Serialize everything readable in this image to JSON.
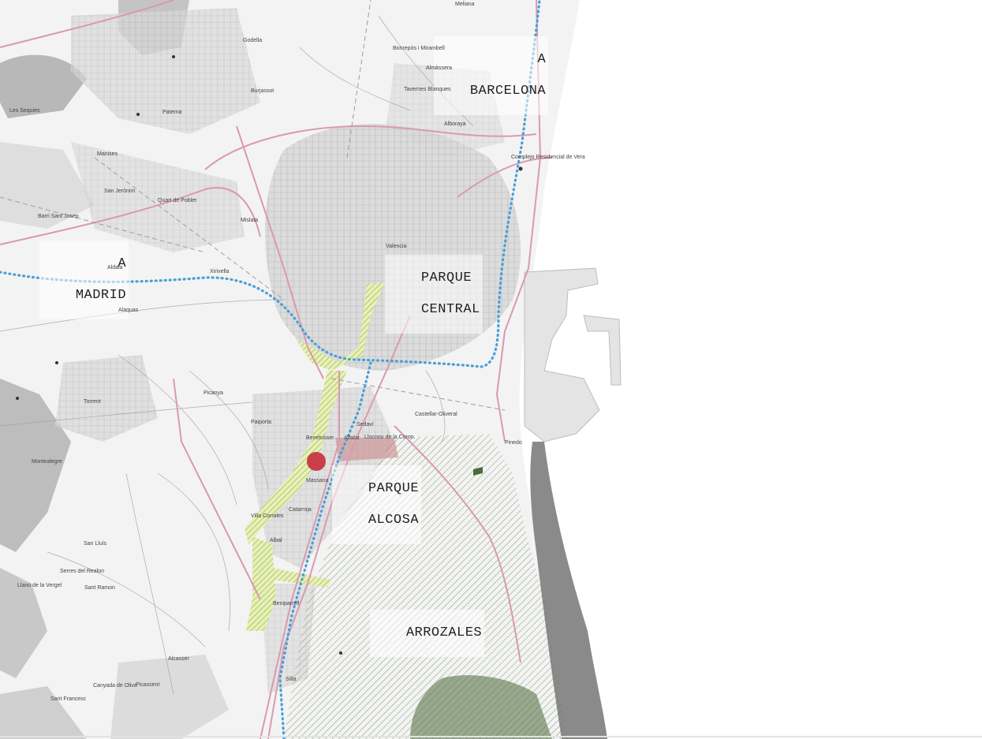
{
  "map": {
    "callouts": {
      "barcelona": [
        "A",
        "BARCELONA"
      ],
      "madrid": [
        "A",
        "MADRID"
      ],
      "parque_central": [
        "PARQUE",
        "CENTRAL"
      ],
      "parque_alcosa": [
        "PARQUE",
        "ALCOSA"
      ],
      "arrozales": "ARROZALES"
    },
    "towns": {
      "godella": "Godella",
      "burjassot": "Burjassot",
      "paterna": "Paterna",
      "manises": "Manises",
      "quart_de_poblet": "Quart de Poblet",
      "mislata": "Mislata",
      "aldaia": "Aldaia",
      "xirivella": "Xirivella",
      "alaquas": "Alaquas",
      "torrent": "Torrent",
      "picanya": "Picanya",
      "paiporta": "Paiporta",
      "benetusser": "Benetusser",
      "alfafar": "Alfafar",
      "lloc_nou": "Llocnou de la Coron.",
      "sedavi": "Sedaví",
      "massanassa": "Massana",
      "catarroja": "Catarroja",
      "albal": "Albal",
      "beniparrell": "Beniparrell",
      "silla": "Silla",
      "alcasser": "Alcasser",
      "picassent": "Picassent",
      "valencia": "Valencia",
      "tavernes_blanques": "Tavernes Blanques",
      "alboraya": "Alboraya",
      "bonrepos": "Bonrepòs i Mirambell",
      "meliana": "Meliana",
      "almassera": "Almàssera",
      "castellar_oliveral": "Castellar-Oliveral",
      "pinedo": "Pinedo",
      "villa_corrales": "Villa Corrales",
      "san_isidro": "San Jerònim",
      "barri_san_jose": "Barri Sant Josep",
      "montealegre": "Montealegre",
      "sierra_perenchiza": "Serres del Realon",
      "llano_vergel": "Llano de la Vergel",
      "canyada_de_oliva": "Canyada de Oliva",
      "san_francisco": "Sant Francesc",
      "les_sequies": "Les Sequies",
      "sant_ramon": "Sant Ramon",
      "san_luis": "San Lluís",
      "complejo_residencial": "Complejo Residencial de Vera"
    },
    "colors": {
      "land": "#f3f3f3",
      "sea": "#ffffff",
      "urban": "#d6d6d6",
      "road_pink": "#d99ab0",
      "rail_blue": "#4a9fd6",
      "green_corridor": "#c4d97a",
      "rice_fields": "#5f7f4a",
      "park_marker": "#c62c3b",
      "coast_dark": "#8a8a8a"
    }
  }
}
